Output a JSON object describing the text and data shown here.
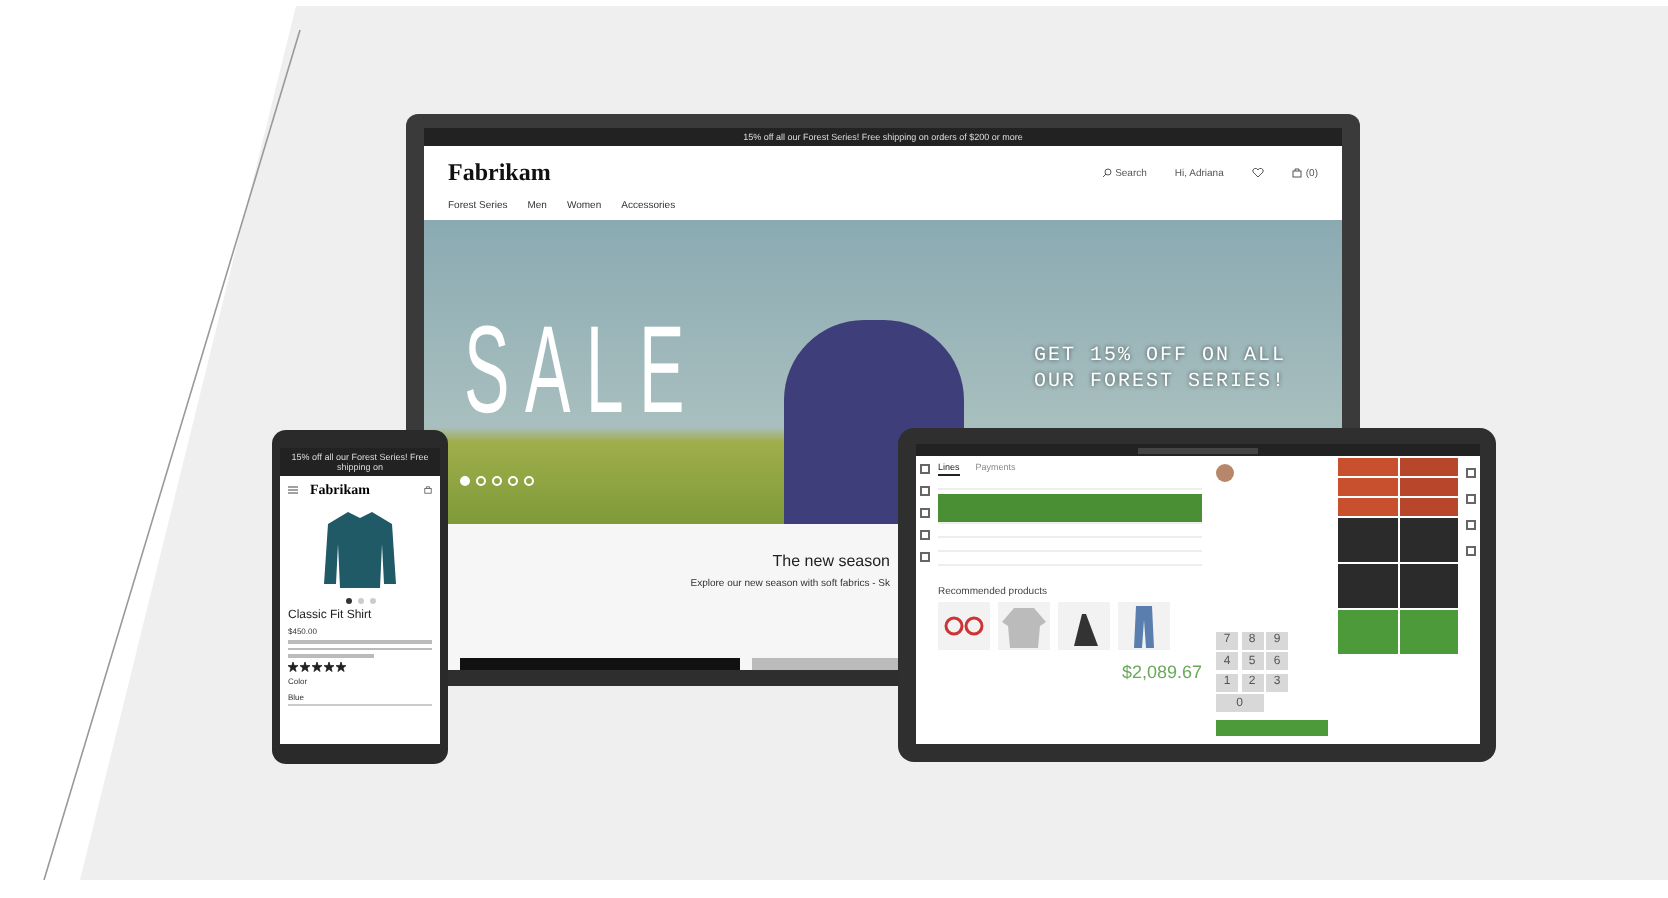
{
  "laptop": {
    "promo": "15% off all our Forest Series! Free shipping on orders of $200 or more",
    "logo": "Fabrikam",
    "search": "Search",
    "account": "Hi, Adriana",
    "cart": "(0)",
    "nav": [
      "Forest Series",
      "Men",
      "Women",
      "Accessories"
    ],
    "hero": {
      "title": "SALE",
      "offer": "GET 15% OFF ON ALL OUR FOREST SERIES!",
      "dots": [
        {
          "selected": true
        },
        {
          "selected": false
        },
        {
          "selected": false
        },
        {
          "selected": false
        },
        {
          "selected": false
        }
      ]
    },
    "heading": "The new season",
    "subheading": "Explore our new season with soft fabrics - Sk"
  },
  "phone": {
    "promo": "15% off all our Forest Series! Free shipping on",
    "logo": "Fabrikam",
    "dots": [
      {
        "selected": true
      },
      {
        "selected": false
      },
      {
        "selected": false
      }
    ],
    "product": "Classic Fit Shirt",
    "price": "$450.00",
    "stars": 5,
    "color_label": "Color",
    "color_value": "Blue"
  },
  "tablet": {
    "tabs": [
      {
        "label": "Lines",
        "selected": true
      },
      {
        "label": "Payments",
        "selected": false
      }
    ],
    "rows": [
      {
        "selected": false
      },
      {
        "selected": true
      },
      {
        "selected": false
      },
      {
        "selected": false
      },
      {
        "selected": false
      }
    ],
    "recommended": "Recommended products",
    "total": "$2,089.67",
    "keys": [
      "7",
      "8",
      "9",
      "4",
      "5",
      "6",
      "1",
      "2",
      "3",
      "0"
    ],
    "tiles": [
      {
        "color": "#c8502f"
      },
      {
        "color": "#b8462a"
      },
      {
        "color": "#c8502f"
      },
      {
        "color": "#b8462a"
      },
      {
        "color": "#c8502f"
      },
      {
        "color": "#b8462a"
      },
      {
        "color": "#2b2b2b"
      },
      {
        "color": "#2b2b2b"
      },
      {
        "color": "#2b2b2b"
      },
      {
        "color": "#2b2b2b"
      },
      {
        "color": "#4c9a3a"
      },
      {
        "color": "#4c9a3a"
      }
    ]
  }
}
